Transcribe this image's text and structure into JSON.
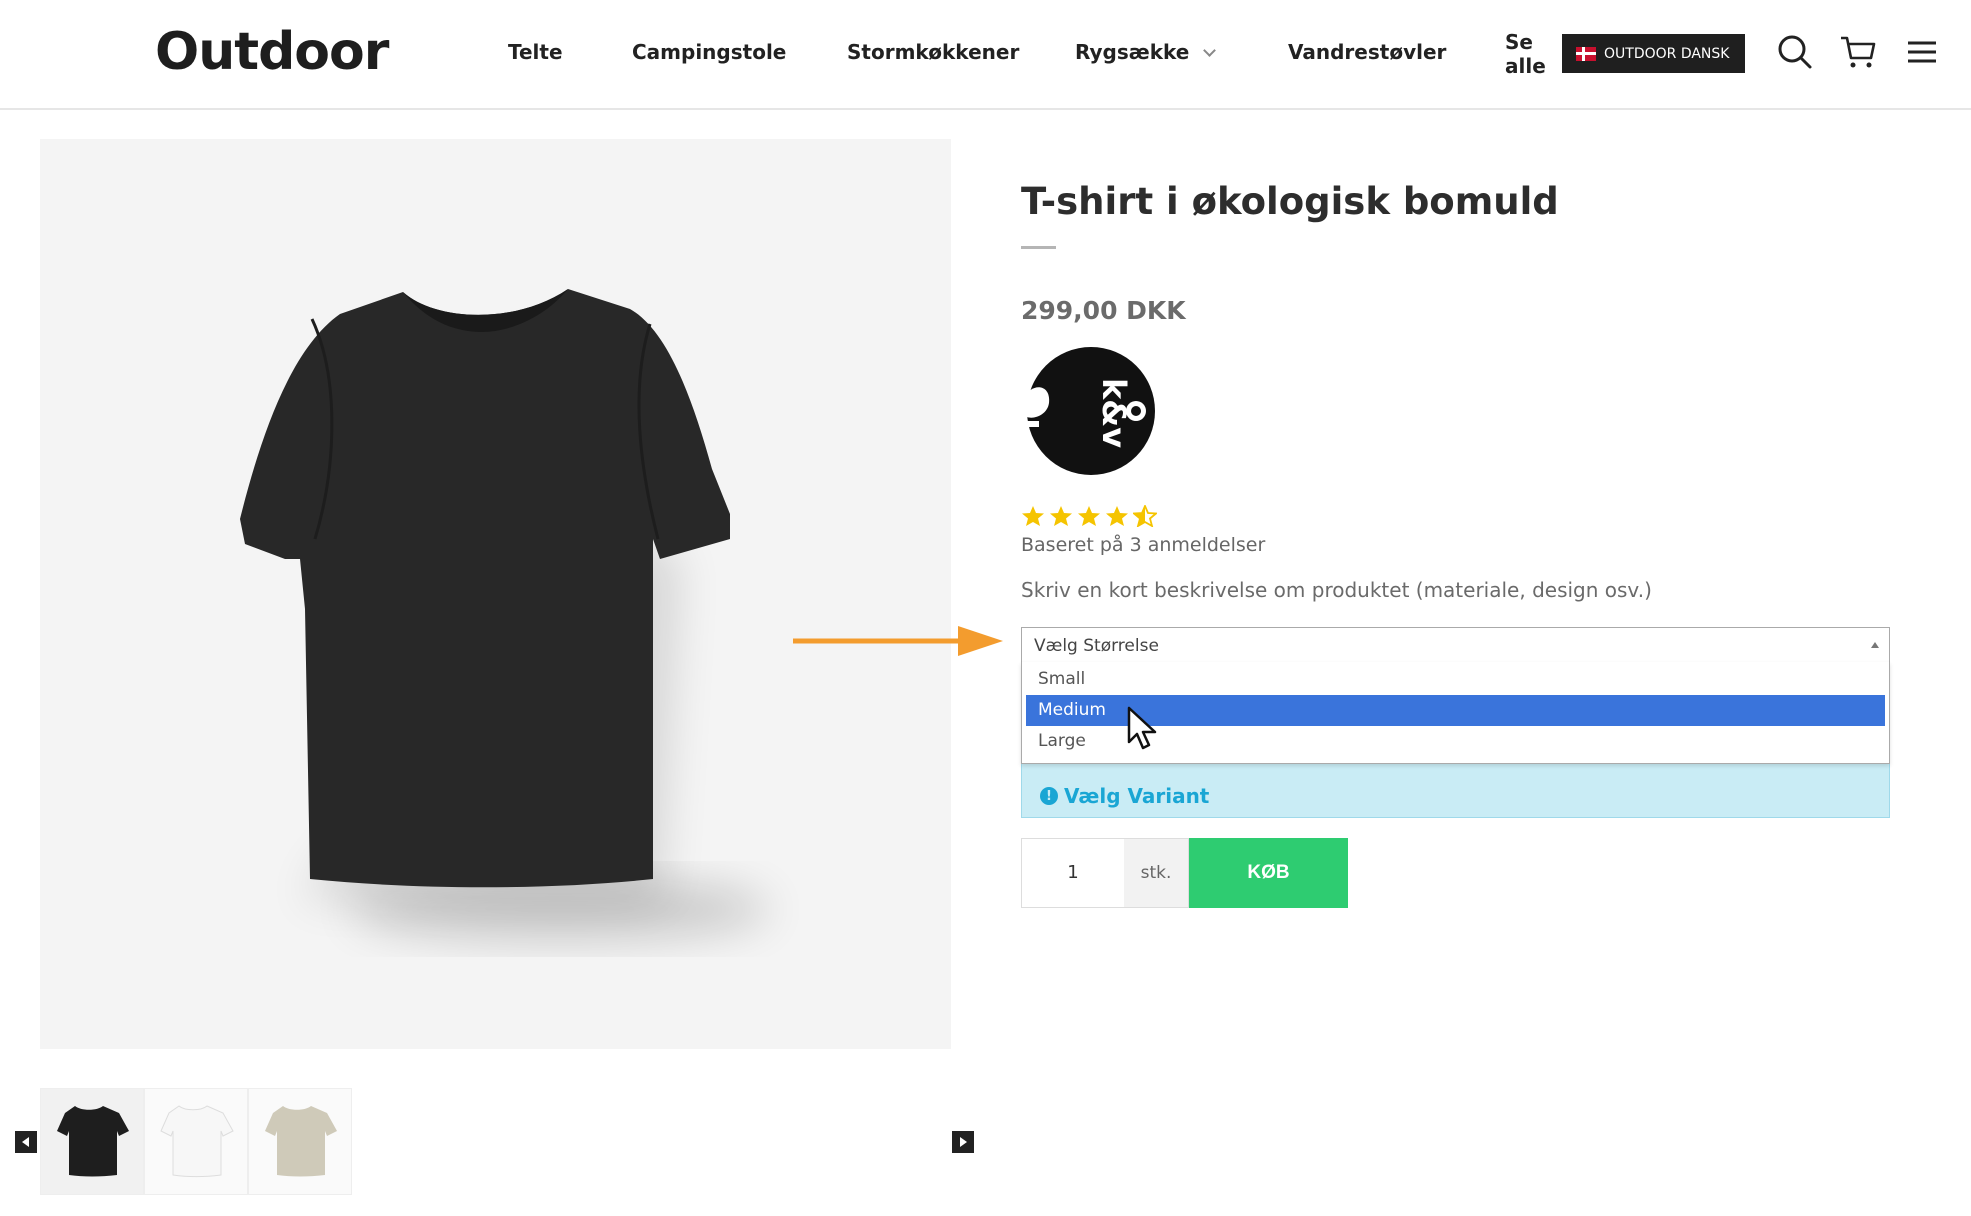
{
  "header": {
    "logo": "Outdoor",
    "nav": [
      {
        "label": "Telte"
      },
      {
        "label": "Campingstole"
      },
      {
        "label": "Stormkøkkener"
      },
      {
        "label": "Rygsække"
      },
      {
        "label": "Vandrestøvler"
      },
      {
        "label": "Se alle"
      }
    ],
    "language_button": "OUTDOOR DANSK"
  },
  "product": {
    "title": "T-shirt i økologisk bomuld",
    "price": "299,00 DKK",
    "rating": 4.5,
    "rating_max": 5,
    "reviews_text": "Baseret på 3 anmeldelser",
    "description": "Skriv en kort beskrivelse om produktet (materiale, design osv.)",
    "thumbnails": [
      {
        "name": "black-tshirt",
        "color": "#1e1e1e"
      },
      {
        "name": "white-tshirt",
        "color": "#f7f7f7"
      },
      {
        "name": "beige-tshirt",
        "color": "#cfcab9"
      }
    ]
  },
  "size_select": {
    "placeholder": "Vælg Størrelse",
    "options": [
      "Small",
      "Medium",
      "Large"
    ],
    "highlighted": "Medium"
  },
  "variant_alert": {
    "icon": "info-icon",
    "text": "Vælg Variant"
  },
  "purchase": {
    "quantity": "1",
    "unit": "stk.",
    "buy_label": "KØB"
  },
  "colors": {
    "buy_green": "#2ecc71",
    "highlight_blue": "#3a74db",
    "alert_bg": "#c9ecf5",
    "alert_text": "#1aa6d4",
    "annotation_arrow": "#f39c2e"
  }
}
